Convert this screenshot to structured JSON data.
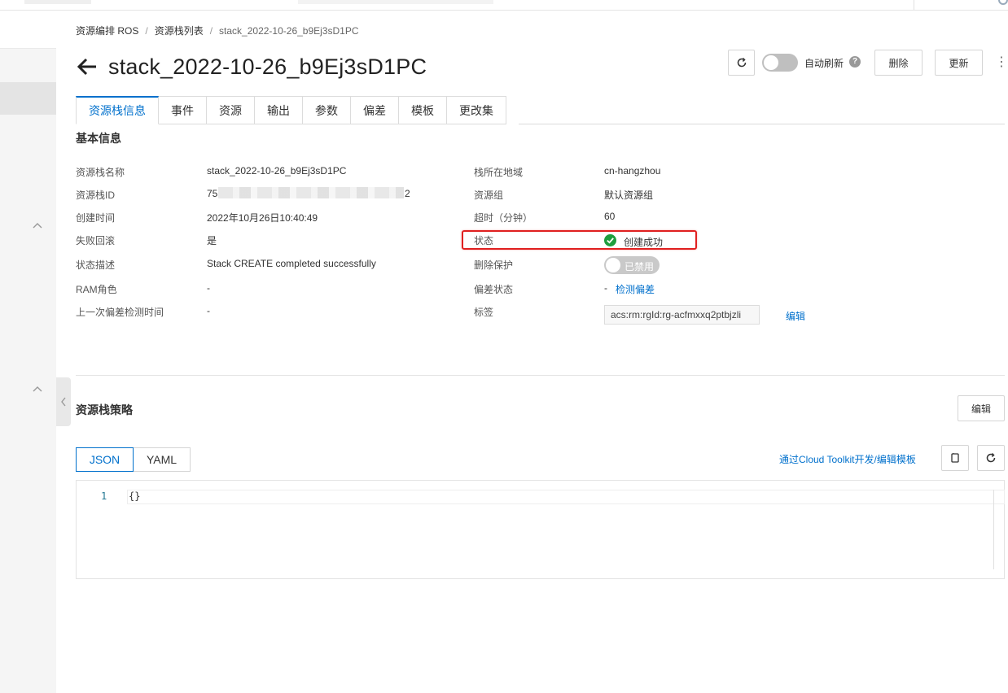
{
  "breadcrumb": {
    "items": [
      "资源编排 ROS",
      "资源栈列表",
      "stack_2022-10-26_b9Ej3sD1PC"
    ],
    "separator": "/"
  },
  "page": {
    "title": "stack_2022-10-26_b9Ej3sD1PC"
  },
  "toolbar": {
    "auto_refresh_label": "自动刷新",
    "auto_refresh_on": false,
    "help_glyph": "?",
    "delete_label": "删除",
    "update_label": "更新",
    "more_glyph": "⋮"
  },
  "tabs": [
    {
      "label": "资源栈信息",
      "active": true
    },
    {
      "label": "事件",
      "active": false
    },
    {
      "label": "资源",
      "active": false
    },
    {
      "label": "输出",
      "active": false
    },
    {
      "label": "参数",
      "active": false
    },
    {
      "label": "偏差",
      "active": false
    },
    {
      "label": "模板",
      "active": false
    },
    {
      "label": "更改集",
      "active": false
    }
  ],
  "basic_info": {
    "title": "基本信息",
    "left": [
      {
        "label": "资源栈名称",
        "value": "stack_2022-10-26_b9Ej3sD1PC"
      },
      {
        "label": "资源栈ID",
        "value_prefix": "75",
        "value_suffix": "2"
      },
      {
        "label": "创建时间",
        "value": "2022年10月26日10:40:49"
      },
      {
        "label": "失败回滚",
        "value": "是"
      },
      {
        "label": "状态描述",
        "value": "Stack CREATE completed successfully"
      },
      {
        "label": "RAM角色",
        "value": "-"
      },
      {
        "label": "上一次偏差检测时间",
        "value": "-"
      }
    ],
    "right": [
      {
        "label": "栈所在地域",
        "value": "cn-hangzhou"
      },
      {
        "label": "资源组",
        "value": "默认资源组"
      },
      {
        "label": "超时（分钟）",
        "value": "60"
      },
      {
        "label": "状态",
        "value": "创建成功"
      },
      {
        "label": "删除保护",
        "value": "已禁用"
      },
      {
        "label": "偏差状态",
        "value": "-",
        "link": "检测偏差"
      },
      {
        "label": "标签",
        "value": "acs:rm:rgId:rg-acfmxxq2ptbjzli",
        "link": "编辑"
      }
    ]
  },
  "policy": {
    "title": "资源栈策略",
    "edit_label": "编辑",
    "format_tabs": [
      {
        "label": "JSON",
        "active": true
      },
      {
        "label": "YAML",
        "active": false
      }
    ],
    "toolkit_link": "通过Cloud Toolkit开发/编辑模板",
    "editor": {
      "line_number": "1",
      "code": "{}"
    }
  },
  "colors": {
    "accent": "#0070cc",
    "success": "#1e9e3e",
    "highlight": "#e02020"
  },
  "icons": [
    "back-arrow-icon",
    "refresh-icon",
    "help-icon",
    "more-icon",
    "check-circle-icon",
    "copy-icon",
    "chevron-up-icon",
    "chevron-left-icon"
  ]
}
